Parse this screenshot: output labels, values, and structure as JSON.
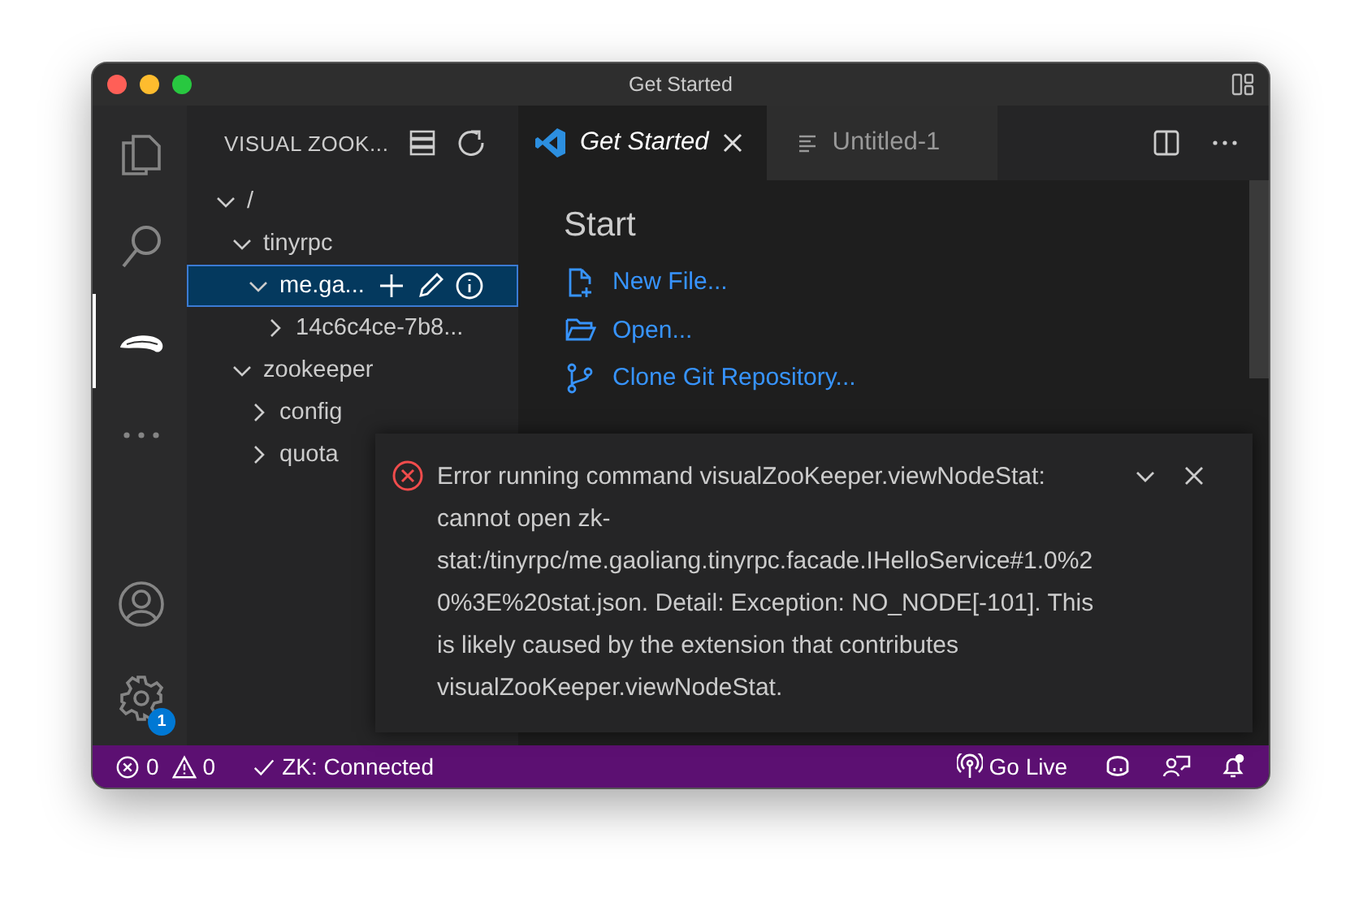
{
  "window": {
    "title": "Get Started"
  },
  "activity_bar": {
    "items": [
      {
        "kind": "files",
        "selected": false
      },
      {
        "kind": "search",
        "selected": false
      },
      {
        "kind": "zookeeper",
        "selected": true
      },
      {
        "kind": "more",
        "selected": false
      }
    ],
    "bottom": [
      {
        "kind": "account"
      },
      {
        "kind": "settings",
        "badge": "1"
      }
    ]
  },
  "sidebar": {
    "title": "VISUAL ZOOK...",
    "tree": [
      {
        "label": "/",
        "expanded": true,
        "selected": false,
        "children": [
          {
            "label": "tinyrpc",
            "expanded": true,
            "selected": false,
            "children": [
              {
                "label": "me.ga...",
                "expanded": true,
                "selected": true,
                "children": [
                  {
                    "label": "14c6c4ce-7b8...",
                    "expanded": false,
                    "selected": false
                  }
                ]
              }
            ]
          },
          {
            "label": "zookeeper",
            "expanded": true,
            "selected": false,
            "children": [
              {
                "label": "config",
                "expanded": false,
                "selected": false
              },
              {
                "label": "quota",
                "expanded": false,
                "selected": false
              }
            ]
          }
        ]
      }
    ]
  },
  "tabs": [
    {
      "label": "Get Started",
      "kind": "welcome",
      "selected": true
    },
    {
      "label": "Untitled-1",
      "kind": "text",
      "selected": false
    }
  ],
  "start": {
    "heading": "Start",
    "actions": [
      {
        "kind": "new-file",
        "label": "New File..."
      },
      {
        "kind": "open",
        "label": "Open..."
      },
      {
        "kind": "clone",
        "label": "Clone Git Repository..."
      }
    ]
  },
  "notification": {
    "kind": "error",
    "message": "Error running command visualZooKeeper.viewNodeStat: cannot open zk-stat:/tinyrpc/me.gaoliang.tinyrpc.facade.IHelloService#1.0%20%3E%20stat.json. Detail: Exception: NO_NODE[-101]. This is likely caused by the extension that contributes visualZooKeeper.viewNodeStat."
  },
  "status_bar": {
    "errors": "0",
    "warnings": "0",
    "zk": "ZK: Connected",
    "go_live": "Go Live"
  }
}
